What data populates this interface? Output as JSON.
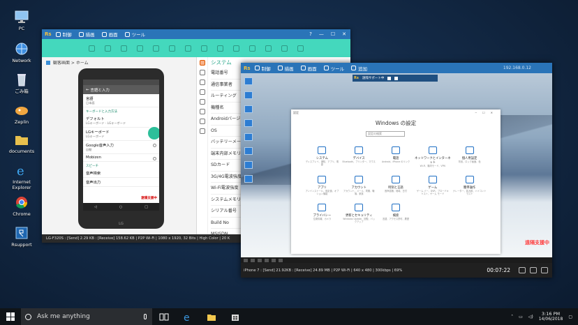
{
  "desktop": {
    "icons": [
      {
        "label": "PC"
      },
      {
        "label": "Network"
      },
      {
        "label": "ごみ箱"
      },
      {
        "label": "Zeplin"
      },
      {
        "label": "documents"
      },
      {
        "label": "Internet Explorer"
      },
      {
        "label": "Chrome"
      },
      {
        "label": "Rsupport"
      }
    ]
  },
  "window_phone": {
    "menu": [
      "制御",
      "描画",
      "画面",
      "ツール"
    ],
    "breadcrumb": "観客画面 > ホーム",
    "phone_screen": {
      "header": "言語と入力",
      "items": [
        {
          "title": "言語",
          "sub": "日本語"
        },
        {
          "section": "キーボードと入力方法"
        },
        {
          "title": "デフォルト",
          "sub": "LGキーボード - LGキーボード"
        },
        {
          "title": "LGキーボード",
          "sub": "LGキーボード"
        },
        {
          "title": "Google音声入力",
          "sub": "自動"
        },
        {
          "title": "Mobizen",
          "sub": ""
        },
        {
          "section": "スピーチ"
        },
        {
          "title": "音声検索",
          "sub": ""
        },
        {
          "title": "音声出力",
          "sub": ""
        }
      ],
      "recording_tag": "遠隔支援中",
      "nav": [
        "◁",
        "○",
        "□"
      ],
      "brand": "LG"
    },
    "info_title": "システム",
    "info_rows": [
      "電話番号",
      "通信事業者",
      "ルーティング",
      "機種名",
      "Androidバージ",
      "OS",
      "バッテリーメー",
      "端末内部メモリ",
      "SDカード",
      "3G/4G電波強度",
      "Wi-Fi電波強度",
      "システムメモリ",
      "シリアル番号",
      "Build No",
      "MSISDN"
    ],
    "status": "LG-F320S : [Send] 2.29 KB : [Receive] 158.62 KB | P2P Wi-Fi | 1080 x 1920, 32 Bits | High Color | 20 K"
  },
  "window_pc": {
    "menu": [
      "制御",
      "描画",
      "画面",
      "ツール",
      "追加"
    ],
    "ip": "192.168.0.12",
    "remote_toolbar": "遠隔サポート中",
    "settings": {
      "window_label": "設定",
      "title": "Windows の設定",
      "search_placeholder": "設定の検索",
      "categories": [
        {
          "title": "システム",
          "desc": "ディスプレイ、通知、アプリ、電源"
        },
        {
          "title": "デバイス",
          "desc": "Bluetooth、プリンター、マウス"
        },
        {
          "title": "電話",
          "desc": "Android、iPhone のリンク"
        },
        {
          "title": "ネットワークとインターネット",
          "desc": "Wi-Fi、機内モード、VPN"
        },
        {
          "title": "個人用設定",
          "desc": "背景、ロック画面、色"
        },
        {
          "title": "アプリ",
          "desc": "アンインストール、既定値、オプション機能"
        },
        {
          "title": "アカウント",
          "desc": "アカウント、メール、同期、職場、家族"
        },
        {
          "title": "時刻と言語",
          "desc": "音声認識、地域、日付"
        },
        {
          "title": "ゲーム",
          "desc": "ゲーム バー、DVR、ブロードキャスト、ゲーム モード"
        },
        {
          "title": "簡単操作",
          "desc": "ナレーター、拡大鏡、ハイコントラスト"
        },
        {
          "title": "プライバシー",
          "desc": "位置情報、カメラ"
        },
        {
          "title": "更新とセキュリティ",
          "desc": "Windows Update、回復、バックアップ"
        },
        {
          "title": "検索",
          "desc": "言語、アクセス許可、履歴"
        }
      ]
    },
    "watermark": "遠隔支援中",
    "status": "iPhone 7 : [Send] 21.92KB : [Receive] 24.89 MB | P2P Wi-Fi | 640 x 480 | 300kbps | 69%",
    "timer": "00:07:22"
  },
  "taskbar": {
    "search_placeholder": "Ask me anything",
    "time": "3:16 PM",
    "date": "14/06/2018"
  }
}
